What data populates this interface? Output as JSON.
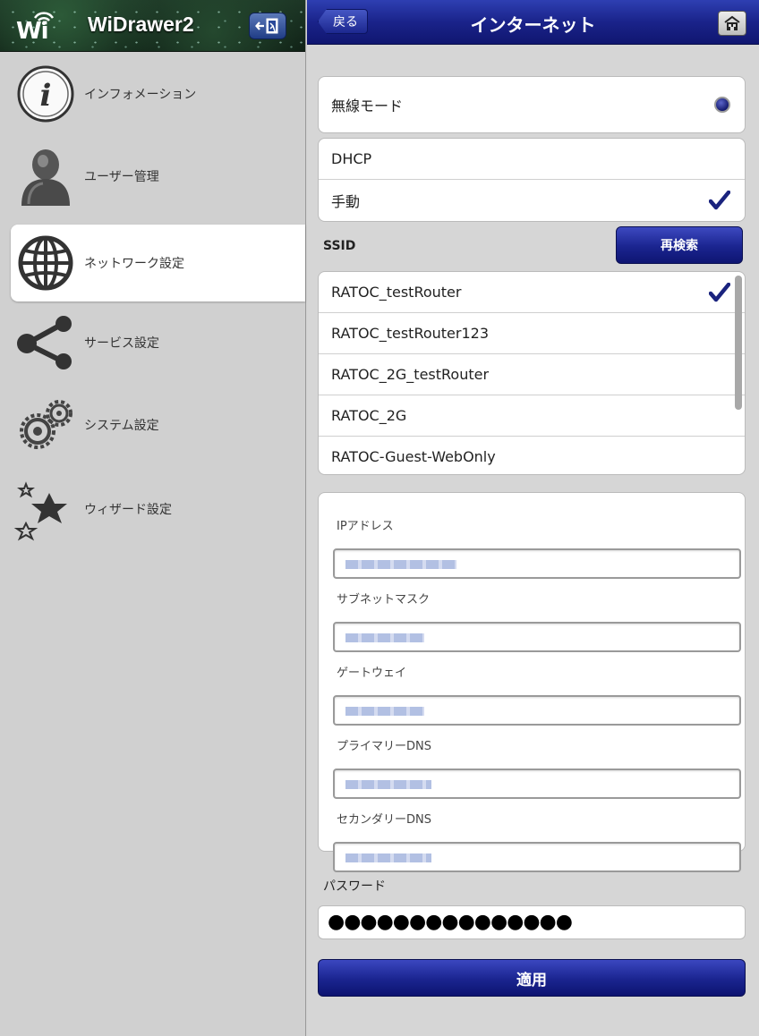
{
  "sidebar": {
    "app_title": "WiDrawer2",
    "logo_text": "Wi",
    "items": [
      {
        "label": "インフォメーション",
        "icon": "info-icon"
      },
      {
        "label": "ユーザー管理",
        "icon": "user-icon"
      },
      {
        "label": "ネットワーク設定",
        "icon": "globe-icon",
        "active": true
      },
      {
        "label": "サービス設定",
        "icon": "share-icon"
      },
      {
        "label": "システム設定",
        "icon": "gears-icon"
      },
      {
        "label": "ウィザード設定",
        "icon": "stars-icon"
      }
    ]
  },
  "header": {
    "back_label": "戻る",
    "title": "インターネット",
    "home_icon": "home-icon"
  },
  "wireless_mode": {
    "label": "無線モード",
    "selected": true
  },
  "ip_mode": {
    "options": [
      {
        "label": "DHCP",
        "checked": false
      },
      {
        "label": "手動",
        "checked": true
      }
    ]
  },
  "ssid": {
    "label": "SSID",
    "rescan_label": "再検索",
    "networks": [
      {
        "name": "RATOC_testRouter",
        "checked": true
      },
      {
        "name": "RATOC_testRouter123",
        "checked": false
      },
      {
        "name": "RATOC_2G_testRouter",
        "checked": false
      },
      {
        "name": "RATOC_2G",
        "checked": false
      },
      {
        "name": "RATOC-Guest-WebOnly",
        "checked": false
      }
    ]
  },
  "ip_settings": {
    "fields": [
      {
        "label": "IPアドレス"
      },
      {
        "label": "サブネットマスク"
      },
      {
        "label": "ゲートウェイ"
      },
      {
        "label": "プライマリーDNS"
      },
      {
        "label": "セカンダリーDNS"
      }
    ]
  },
  "password": {
    "label": "パスワード",
    "masked_value": "●●●●●●●●●●●●●●●"
  },
  "apply_label": "適用",
  "colors": {
    "accent_blue": "#1a248f",
    "check_blue": "#1a237e"
  }
}
